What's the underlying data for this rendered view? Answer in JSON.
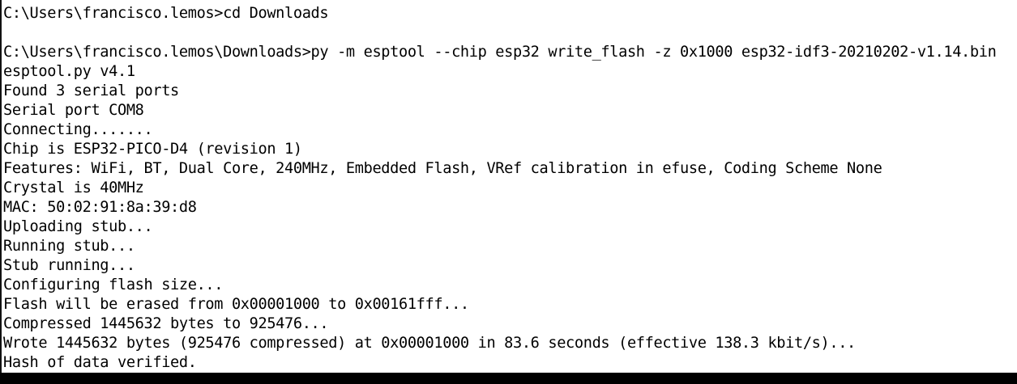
{
  "terminal": {
    "lines": [
      "C:\\Users\\francisco.lemos>cd Downloads",
      "",
      "C:\\Users\\francisco.lemos\\Downloads>py -m esptool --chip esp32 write_flash -z 0x1000 esp32-idf3-20210202-v1.14.bin",
      "esptool.py v4.1",
      "Found 3 serial ports",
      "Serial port COM8",
      "Connecting.......",
      "Chip is ESP32-PICO-D4 (revision 1)",
      "Features: WiFi, BT, Dual Core, 240MHz, Embedded Flash, VRef calibration in efuse, Coding Scheme None",
      "Crystal is 40MHz",
      "MAC: 50:02:91:8a:39:d8",
      "Uploading stub...",
      "Running stub...",
      "Stub running...",
      "Configuring flash size...",
      "Flash will be erased from 0x00001000 to 0x00161fff...",
      "Compressed 1445632 bytes to 925476...",
      "Wrote 1445632 bytes (925476 compressed) at 0x00001000 in 83.6 seconds (effective 138.3 kbit/s)...",
      "Hash of data verified."
    ]
  },
  "colors": {
    "background": "#ffffff",
    "text": "#000000"
  }
}
